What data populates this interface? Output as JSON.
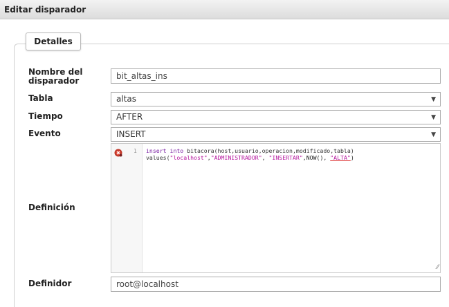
{
  "window": {
    "title": "Editar disparador"
  },
  "fieldset": {
    "legend": "Detalles"
  },
  "form": {
    "name_label_line1": "Nombre del",
    "name_label_line2": "disparador",
    "name_value": "bit_altas_ins",
    "table_label": "Tabla",
    "table_value": "altas",
    "time_label": "Tiempo",
    "time_value": "AFTER",
    "event_label": "Evento",
    "event_value": "INSERT",
    "definition_label": "Definición",
    "definer_label": "Definidor",
    "definer_value": "root@localhost"
  },
  "editor": {
    "line_number": "1",
    "line1_kw1": "insert",
    "line1_kw2": "into",
    "line1_rest": " bitacora(host,usuario,operacion,modificado,tabla)",
    "line2_fn": "values(",
    "line2_s1": "\"localhost\"",
    "line2_c1": ",",
    "line2_s2": "\"ADMINISTRADOR\"",
    "line2_c2": ", ",
    "line2_s3": "\"INSERTAR\"",
    "line2_c3": ",NOW(), ",
    "line2_s4": "\"ALTA\"",
    "line2_end": ")"
  },
  "icons": {
    "dropdown": "chevron-down",
    "lint": "error-lint-marker",
    "resize": "resize-handle"
  }
}
